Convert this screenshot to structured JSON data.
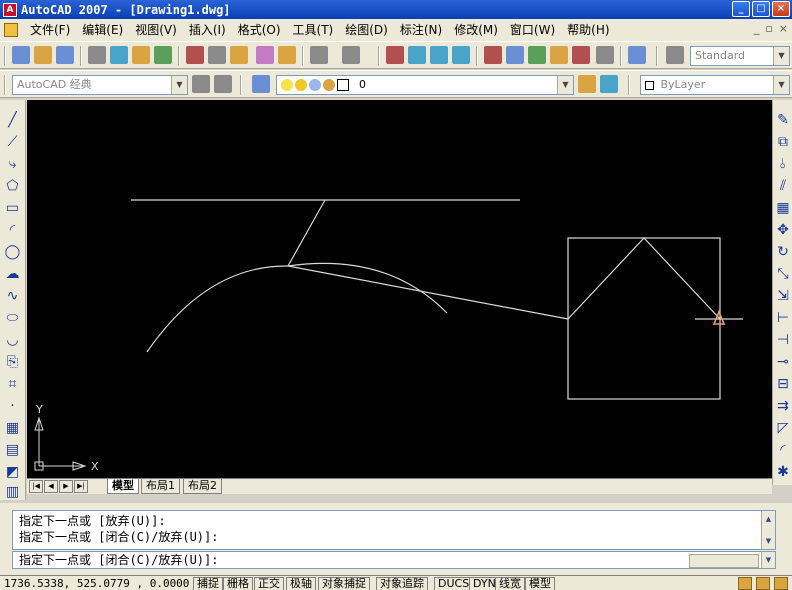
{
  "window": {
    "title": "AutoCAD 2007 - [Drawing1.dwg]",
    "icon": "autocad-logo-icon",
    "controls": [
      "_",
      "□",
      "×"
    ]
  },
  "menu": {
    "items": [
      "文件(F)",
      "编辑(E)",
      "视图(V)",
      "插入(I)",
      "格式(O)",
      "工具(T)",
      "绘图(D)",
      "标注(N)",
      "修改(M)",
      "窗口(W)",
      "帮助(H)"
    ],
    "doc_controls": [
      "_",
      "▫",
      "×"
    ]
  },
  "toolbar1": {
    "text_style": "Standard"
  },
  "toolbar2": {
    "workspace": "AutoCAD 经典",
    "layer": "0",
    "color": "ByLayer"
  },
  "canvas": {
    "background": "#000000",
    "ucs_y": "Y",
    "ucs_x": "X"
  },
  "layout_tabs": {
    "nav": [
      "|◀",
      "◀",
      "▶",
      "▶|"
    ],
    "tabs": [
      "模型",
      "布局1",
      "布局2"
    ],
    "active": "模型"
  },
  "command": {
    "history": [
      "指定下一点或 [放弃(U)]:",
      "指定下一点或 [闭合(C)/放弃(U)]:"
    ],
    "prompt": "指定下一点或 [闭合(C)/放弃(U)]:"
  },
  "status": {
    "coordinates": "1736.5338, 525.0779 , 0.0000",
    "toggles": [
      "捕捉",
      "栅格",
      "正交",
      "极轴",
      "对象捕捉",
      "对象追踪",
      "DUCS",
      "DYN",
      "线宽",
      "模型"
    ]
  }
}
